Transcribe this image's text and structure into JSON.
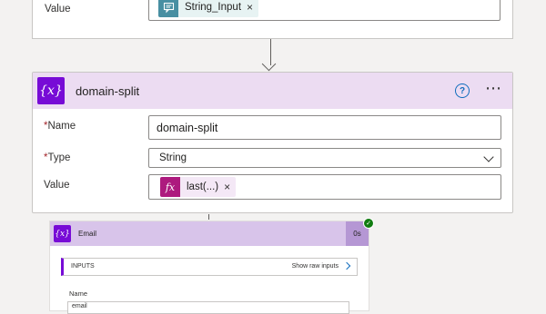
{
  "top_card": {
    "value_label": "Value",
    "token": {
      "text": "String_Input",
      "remove": "×",
      "icon": "chat-input-icon",
      "color": "#488fa2"
    }
  },
  "main_card": {
    "icon_text": "{x}",
    "title": "domain-split",
    "help_icon": "?",
    "more_icon": "⋯",
    "name_label": "Name",
    "name_required": "*",
    "name_value": "domain-split",
    "type_label": "Type",
    "type_required": "*",
    "type_value": "String",
    "value_label": "Value",
    "value_token": {
      "icon_text": "fx",
      "text": "last(...)",
      "remove": "×"
    },
    "accent_color": "#770bd6",
    "header_color": "#ecdcf2"
  },
  "run_card": {
    "icon_text": "{x}",
    "title": "Email",
    "duration": "0s",
    "status": "✓",
    "status_color": "#107c10",
    "inputs_label": "INPUTS",
    "show_raw_label": "Show raw inputs",
    "name_label": "Name",
    "name_value": "email"
  }
}
